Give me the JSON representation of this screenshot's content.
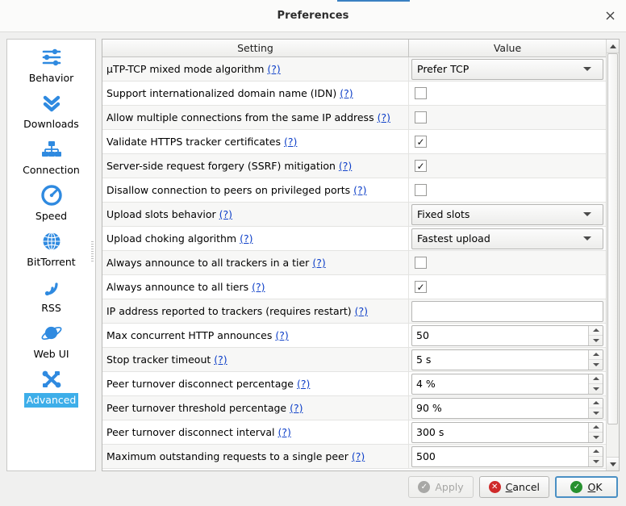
{
  "window": {
    "title": "Preferences",
    "close_icon": "close-icon"
  },
  "sidebar": {
    "items": [
      {
        "label": "Behavior",
        "icon": "sliders-icon",
        "selected": false
      },
      {
        "label": "Downloads",
        "icon": "double-chevron-down-icon",
        "selected": false
      },
      {
        "label": "Connection",
        "icon": "network-icon",
        "selected": false
      },
      {
        "label": "Speed",
        "icon": "gauge-icon",
        "selected": false
      },
      {
        "label": "BitTorrent",
        "icon": "globe-icon",
        "selected": false
      },
      {
        "label": "RSS",
        "icon": "rss-icon",
        "selected": false
      },
      {
        "label": "Web UI",
        "icon": "planet-icon",
        "selected": false
      },
      {
        "label": "Advanced",
        "icon": "tools-icon",
        "selected": true
      }
    ]
  },
  "table": {
    "columns": {
      "setting": "Setting",
      "value": "Value"
    },
    "help_marker": "(?)",
    "rows": [
      {
        "setting": "µTP-TCP mixed mode algorithm",
        "help": "(?)",
        "type": "combo",
        "value": "Prefer TCP"
      },
      {
        "setting": "Support internationalized domain name (IDN)",
        "help": "(?)",
        "type": "checkbox",
        "checked": false
      },
      {
        "setting": "Allow multiple connections from the same IP address",
        "help": "(?)",
        "type": "checkbox",
        "checked": false
      },
      {
        "setting": "Validate HTTPS tracker certificates",
        "help": "(?)",
        "type": "checkbox",
        "checked": true
      },
      {
        "setting": "Server-side request forgery (SSRF) mitigation",
        "help": "(?)",
        "type": "checkbox",
        "checked": true
      },
      {
        "setting": "Disallow connection to peers on privileged ports",
        "help": "(?)",
        "type": "checkbox",
        "checked": false
      },
      {
        "setting": "Upload slots behavior",
        "help": "(?)",
        "type": "combo",
        "value": "Fixed slots"
      },
      {
        "setting": "Upload choking algorithm",
        "help": "(?)",
        "type": "combo",
        "value": "Fastest upload"
      },
      {
        "setting": "Always announce to all trackers in a tier",
        "help": "(?)",
        "type": "checkbox",
        "checked": false
      },
      {
        "setting": "Always announce to all tiers",
        "help": "(?)",
        "type": "checkbox",
        "checked": true
      },
      {
        "setting": "IP address reported to trackers (requires restart)",
        "help": "(?)",
        "type": "text",
        "value": ""
      },
      {
        "setting": "Max concurrent HTTP announces",
        "help": "(?)",
        "type": "spin",
        "value": "50"
      },
      {
        "setting": "Stop tracker timeout",
        "help": "(?)",
        "type": "spin",
        "value": "5 s"
      },
      {
        "setting": "Peer turnover disconnect percentage",
        "help": "(?)",
        "type": "spin",
        "value": "4 %"
      },
      {
        "setting": "Peer turnover threshold percentage",
        "help": "(?)",
        "type": "spin",
        "value": "90 %"
      },
      {
        "setting": "Peer turnover disconnect interval",
        "help": "(?)",
        "type": "spin",
        "value": "300 s"
      },
      {
        "setting": "Maximum outstanding requests to a single peer",
        "help": "(?)",
        "type": "spin",
        "value": "500"
      }
    ]
  },
  "footer": {
    "apply": {
      "label": "Apply",
      "enabled": false,
      "icon": "check-circle-grey-icon"
    },
    "cancel": {
      "label_before": "",
      "mnemonic": "C",
      "label_after": "ancel",
      "icon": "cross-circle-red-icon"
    },
    "ok": {
      "label_before": "",
      "mnemonic": "O",
      "label_after": "K",
      "icon": "check-circle-green-icon",
      "default": true
    }
  },
  "colors": {
    "accent": "#2f8ae0",
    "selection": "#3daee9",
    "link": "#0f40c8",
    "ok_green": "#27912f",
    "cancel_red": "#cf2a2a"
  }
}
